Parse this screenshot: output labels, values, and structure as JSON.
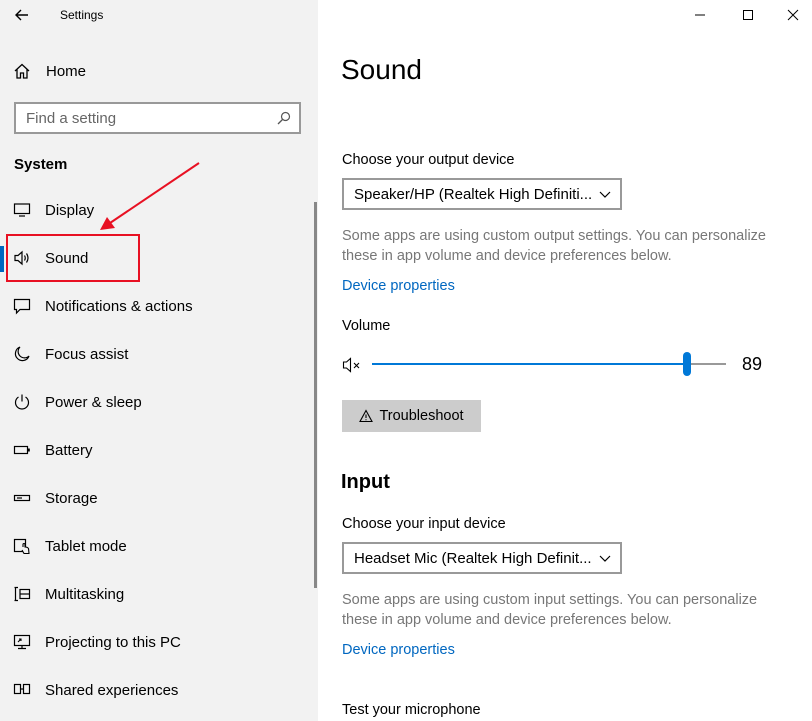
{
  "window": {
    "title": "Settings"
  },
  "sidebar": {
    "home_label": "Home",
    "search_placeholder": "Find a setting",
    "section_label": "System",
    "items": [
      {
        "label": "Display",
        "icon": "display-icon"
      },
      {
        "label": "Sound",
        "icon": "speaker-icon",
        "selected": true
      },
      {
        "label": "Notifications & actions",
        "icon": "notifications-icon"
      },
      {
        "label": "Focus assist",
        "icon": "moon-icon"
      },
      {
        "label": "Power & sleep",
        "icon": "power-icon"
      },
      {
        "label": "Battery",
        "icon": "battery-icon"
      },
      {
        "label": "Storage",
        "icon": "storage-icon"
      },
      {
        "label": "Tablet mode",
        "icon": "tablet-mode-icon"
      },
      {
        "label": "Multitasking",
        "icon": "multitasking-icon"
      },
      {
        "label": "Projecting to this PC",
        "icon": "projecting-icon"
      },
      {
        "label": "Shared experiences",
        "icon": "shared-experiences-icon"
      }
    ]
  },
  "main": {
    "title": "Sound",
    "output": {
      "label": "Choose your output device",
      "device": "Speaker/HP (Realtek High Definiti...",
      "help": "Some apps are using custom output settings. You can personalize these in app volume and device preferences below.",
      "link": "Device properties"
    },
    "volume": {
      "label": "Volume",
      "value": "89",
      "level": 89
    },
    "troubleshoot_label": "Troubleshoot",
    "input": {
      "section_title": "Input",
      "label": "Choose your input device",
      "device": "Headset Mic (Realtek High Definit...",
      "help": "Some apps are using custom input settings. You can personalize these in app volume and device preferences below.",
      "link": "Device properties",
      "test_label": "Test your microphone"
    }
  },
  "colors": {
    "accent": "#0067c0",
    "slider": "#0078d7",
    "annotation": "#e81123",
    "sidebar_bg": "#f2f2f2"
  }
}
